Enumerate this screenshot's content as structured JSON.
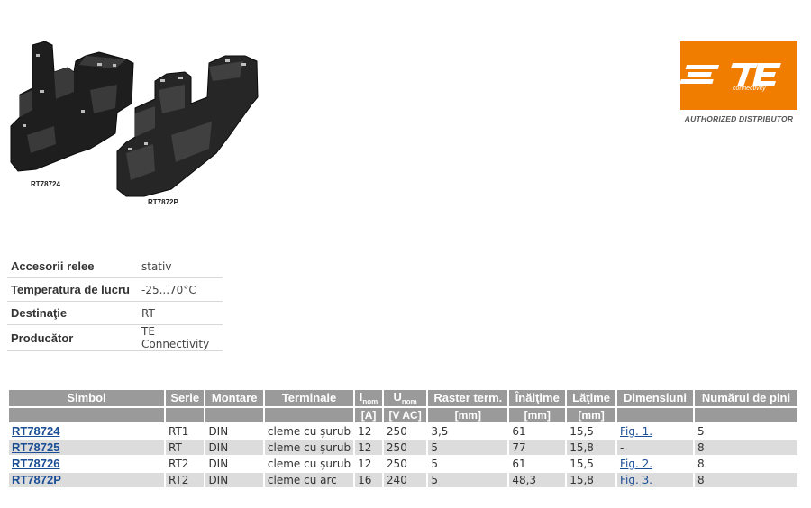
{
  "images": {
    "label1": "RT78724",
    "label2": "RT7872P"
  },
  "logo": {
    "mark": "TE",
    "sub": "connectivity",
    "caption": "AUTHORIZED DISTRIBUTOR",
    "color": "#f07d00"
  },
  "specs": [
    {
      "key": "Accesorii relee",
      "value": "stativ"
    },
    {
      "key": "Temperatura de lucru",
      "value": "-25...70°C"
    },
    {
      "key": "Destinaţie",
      "value": "RT"
    },
    {
      "key": "Producător",
      "value": "TE Connectivity"
    }
  ],
  "table": {
    "headers": {
      "simbol": "Simbol",
      "serie": "Serie",
      "montare": "Montare",
      "terminale": "Terminale",
      "inom": "I",
      "inom_sub": "nom",
      "unom": "U",
      "unom_sub": "nom",
      "raster": "Raster term.",
      "inaltime": "Înălţime",
      "latime": "Lăţime",
      "dimensiuni": "Dimensiuni",
      "pini": "Numărul de pini"
    },
    "units": {
      "inom": "[A]",
      "unom": "[V AC]",
      "raster": "[mm]",
      "inaltime": "[mm]",
      "latime": "[mm]"
    },
    "rows": [
      {
        "simbol": "RT78724",
        "serie": "RT1",
        "montare": "DIN",
        "terminale": "cleme cu şurub",
        "inom": "12",
        "unom": "250",
        "raster": "3,5",
        "inaltime": "61",
        "latime": "15,5",
        "dim": "Fig. 1.",
        "pini": "5"
      },
      {
        "simbol": "RT78725",
        "serie": "RT",
        "montare": "DIN",
        "terminale": "cleme cu şurub",
        "inom": "12",
        "unom": "250",
        "raster": "5",
        "inaltime": "77",
        "latime": "15,8",
        "dim": "-",
        "pini": "8"
      },
      {
        "simbol": "RT78726",
        "serie": "RT2",
        "montare": "DIN",
        "terminale": "cleme cu şurub",
        "inom": "12",
        "unom": "250",
        "raster": "5",
        "inaltime": "61",
        "latime": "15,5",
        "dim": "Fig. 2.",
        "pini": "8"
      },
      {
        "simbol": "RT7872P",
        "serie": "RT2",
        "montare": "DIN",
        "terminale": "cleme cu arc",
        "inom": "16",
        "unom": "240",
        "raster": "5",
        "inaltime": "48,3",
        "latime": "15,8",
        "dim": "Fig. 3.",
        "pini": "8"
      }
    ]
  }
}
